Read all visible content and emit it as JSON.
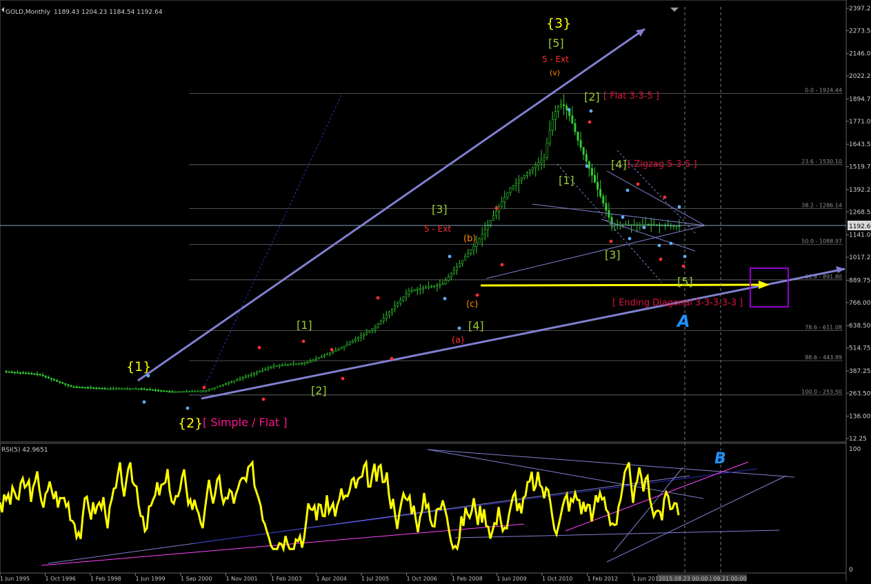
{
  "header": {
    "symbol": "GOLD,Monthly",
    "ohlc": "1189.43 1204.23 1184.54 1192.64"
  },
  "price_panel": {
    "axis_ticks": [
      "2397.25",
      "2273.50",
      "2146.00",
      "2022.25",
      "1894.75",
      "1771.00",
      "1643.50",
      "1519.75",
      "1392.25",
      "1268.50",
      "1141.00",
      "1017.25",
      "889.75",
      "766.00",
      "638.50",
      "514.75",
      "387.25",
      "263.50",
      "136.00",
      "12.25"
    ],
    "current_price": "1192.64",
    "fib_levels": [
      {
        "label": "0.0 - 1924.44",
        "price": 1924.44
      },
      {
        "label": "23.6 - 1530.10",
        "price": 1530.1
      },
      {
        "label": "38.2 - 1286.14",
        "price": 1286.14
      },
      {
        "label": "50.0 - 1088.97",
        "price": 1088.97
      },
      {
        "label": "61.8 - 891.80",
        "price": 891.8
      },
      {
        "label": "78.6 - 611.08",
        "price": 611.08
      },
      {
        "label": "88.6 - 443.99",
        "price": 443.99
      },
      {
        "label": "100.0 - 253.50",
        "price": 253.5
      }
    ],
    "wave_labels": [
      {
        "text": "{3}",
        "color": "#ffff00",
        "big": true
      },
      {
        "text": "[5]",
        "color": "#9acd32",
        "big": true
      },
      {
        "text": "5 - Ext",
        "color": "#ff3030"
      },
      {
        "text": "(v)",
        "color": "#ff8c00"
      },
      {
        "text": "[2]",
        "color": "#9acd32",
        "big": true
      },
      {
        "text": "[ Flat 3-3-5 ]",
        "color": "#dc143c"
      },
      {
        "text": "[4]",
        "color": "#9acd32",
        "big": true
      },
      {
        "text": "[ Zigzag 5-3-5 ]",
        "color": "#dc143c"
      },
      {
        "text": "[1]",
        "color": "#9acd32",
        "big": true
      },
      {
        "text": "[3]",
        "color": "#9acd32",
        "big": true
      },
      {
        "text": "[5]",
        "color": "#9acd32",
        "big": true
      },
      {
        "text": "[ Ending Diagonal 3-3-3-3-3 ]",
        "color": "#dc143c"
      },
      {
        "text": "[3]",
        "color": "#9acd32",
        "big": true
      },
      {
        "text": "5 - Ext",
        "color": "#ff3030"
      },
      {
        "text": "(b)",
        "color": "#ff8c00"
      },
      {
        "text": "(c)",
        "color": "#ff8c00"
      },
      {
        "text": "(a)",
        "color": "#ff3030"
      },
      {
        "text": "[4]",
        "color": "#9acd32",
        "big": true
      },
      {
        "text": "[1]",
        "color": "#9acd32",
        "big": true
      },
      {
        "text": "[2]",
        "color": "#9acd32",
        "big": true
      },
      {
        "text": "{1}",
        "color": "#ffff00",
        "big": true
      },
      {
        "text": "{2}",
        "color": "#ffff00",
        "big": true
      },
      {
        "text": "[ Simple / Flat ]",
        "color": "#ff1493",
        "big": true
      },
      {
        "text": "A",
        "color": "#1e90ff",
        "big": true
      }
    ]
  },
  "rsi_panel": {
    "title": "RSI(5) 42.9651",
    "axis_ticks": [
      "100",
      "0"
    ],
    "marker": "B"
  },
  "time_axis": {
    "ticks": [
      "1 Jun 1995",
      "1 Oct 1996",
      "1 Feb 1998",
      "1 Jun 1999",
      "1 Sep 2000",
      "1 Nov 2001",
      "1 Feb 2003",
      "1 Apr 2004",
      "1 Jul 2005",
      "1 Oct 2006",
      "1 Feb 2008",
      "1 Jun 2009",
      "1 Oct 2010",
      "1 Feb 2012",
      "1 Jun 2013"
    ],
    "cursor_dates": "2015.08.23 00:00 | 09.21 00:00"
  },
  "chart_data": {
    "type": "candlestick",
    "title": "GOLD,Monthly",
    "x": [
      "1995",
      "1996",
      "1997",
      "1998",
      "1999",
      "2000",
      "2001",
      "2002",
      "2003",
      "2004",
      "2005",
      "2006",
      "2007",
      "2008",
      "2009",
      "2010",
      "2011",
      "2012",
      "2013",
      "2014",
      "2015"
    ],
    "close_approx": [
      385,
      370,
      300,
      290,
      290,
      272,
      278,
      345,
      415,
      435,
      515,
      630,
      830,
      870,
      1095,
      1400,
      1570,
      1665,
      1200,
      1200,
      1192.64
    ],
    "high_2011": 1924.44,
    "ylim": [
      12.25,
      2397.25
    ],
    "rsi_ylim": [
      0,
      100
    ],
    "colors": {
      "up": "#32cd32",
      "line": "#8080d0",
      "rsi": "#ffff00",
      "fib": "#808080",
      "target": "#9400d3"
    }
  }
}
